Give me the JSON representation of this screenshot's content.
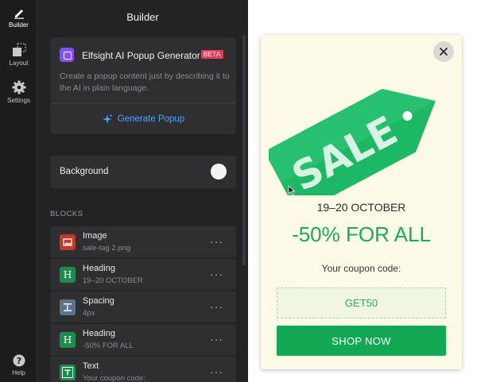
{
  "rail": {
    "items": [
      {
        "label": "Builder",
        "icon": "pencil-icon"
      },
      {
        "label": "Layout",
        "icon": "layout-icon"
      },
      {
        "label": "Settings",
        "icon": "gear-icon"
      },
      {
        "label": "Help",
        "icon": "help-icon"
      }
    ]
  },
  "panel": {
    "title": "Builder",
    "ai": {
      "title": "Elfsight AI Popup Generator",
      "badge": "BETA",
      "description": "Create a popup content just by describing it to the AI in plain language.",
      "button": "Generate Popup"
    },
    "background": {
      "label": "Background",
      "enabled": false
    },
    "blocks_label": "BLOCKS",
    "blocks": [
      {
        "name": "Image",
        "detail": "sale-tag 2.png",
        "icon": "image-icon",
        "color": "#c0392b"
      },
      {
        "name": "Heading",
        "detail": "19–20 OCTOBER",
        "icon": "heading-icon",
        "color": "#1e8c4e"
      },
      {
        "name": "Spacing",
        "detail": "4px",
        "icon": "spacing-icon",
        "color": "#5d7389"
      },
      {
        "name": "Heading",
        "detail": "-50% FOR ALL",
        "icon": "heading-icon",
        "color": "#1e8c4e"
      },
      {
        "name": "Text",
        "detail": "Your coupon code:",
        "icon": "text-icon",
        "color": "#1e8c4e"
      }
    ],
    "more_glyph": "···"
  },
  "preview": {
    "sale_word": "SALE",
    "date": "19–20 OCTOBER",
    "discount": "-50% FOR ALL",
    "coupon_label": "Your coupon code:",
    "coupon_code": "GET50",
    "cta": "SHOP NOW",
    "colors": {
      "accent": "#12a854",
      "popup_bg": "#fdfbe8",
      "panel_bg": "#232325"
    }
  }
}
